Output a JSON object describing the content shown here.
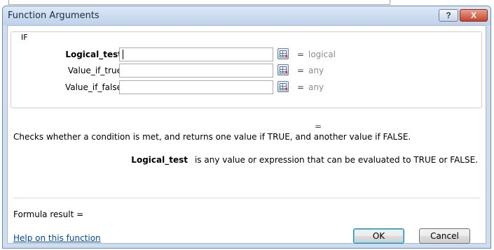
{
  "dialog": {
    "title": "Function Arguments",
    "help_glyph": "?",
    "close_glyph": "X"
  },
  "function_group": {
    "name": "IF",
    "arguments": [
      {
        "label": "Logical_test",
        "value": "",
        "result": "logical",
        "active": true
      },
      {
        "label": "Value_if_true",
        "value": "",
        "result": "any",
        "active": false
      },
      {
        "label": "Value_if_false",
        "value": "",
        "result": "any",
        "active": false
      }
    ],
    "equals_sign": "="
  },
  "function_result_equals": "=",
  "description": "Checks whether a condition is met, and returns one value if TRUE, and another value if FALSE.",
  "argument_help": {
    "name": "Logical_test",
    "text": "is any value or expression that can be evaluated to TRUE or FALSE."
  },
  "formula_result_label": "Formula result =",
  "help_link": "Help on this function",
  "buttons": {
    "ok": "OK",
    "cancel": "Cancel"
  },
  "colors": {
    "accent_link": "#0047ab",
    "title_bar": "#bfd2ea",
    "close_button": "#c4452b",
    "result_text": "#8c8c8c"
  }
}
